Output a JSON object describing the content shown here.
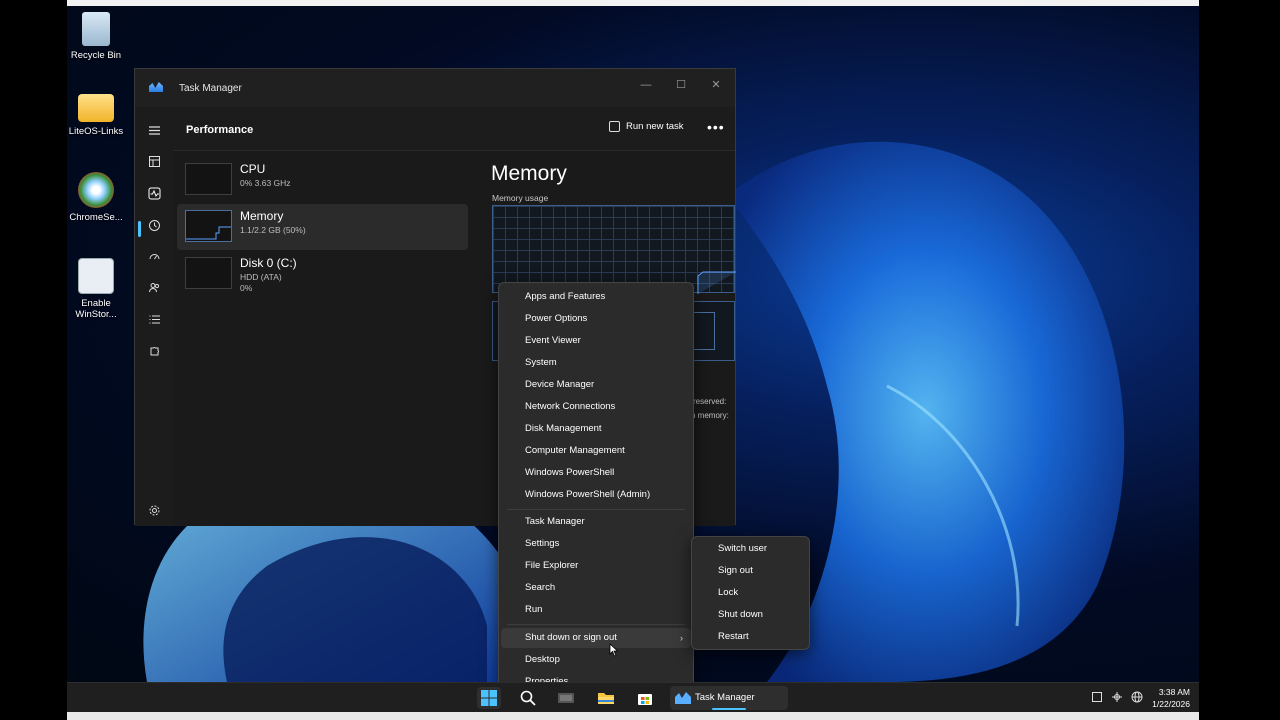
{
  "desktop": {
    "icons": [
      {
        "label": "Recycle Bin"
      },
      {
        "label": "LiteOS-Links"
      },
      {
        "label": "ChromeSe..."
      },
      {
        "label": "Enable WinStor..."
      }
    ]
  },
  "task_manager": {
    "title": "Task Manager",
    "page_title": "Performance",
    "run_new_task": "Run new task",
    "more": "•••",
    "perf_items": [
      {
        "name": "CPU",
        "sub": "0%  3.63 GHz"
      },
      {
        "name": "Memory",
        "sub": "1.1/2.2 GB (50%)"
      },
      {
        "name": "Disk 0 (C:)",
        "sub": "HDD (ATA)\n0%"
      }
    ],
    "detail_title": "Memory",
    "detail_usage_label": "Memory usage",
    "partial": {
      "reserved": "reserved:",
      "memory": "n memory:"
    }
  },
  "context_menu": {
    "items": [
      "Apps and Features",
      "Power Options",
      "Event Viewer",
      "System",
      "Device Manager",
      "Network Connections",
      "Disk Management",
      "Computer Management",
      "Windows PowerShell",
      "Windows PowerShell (Admin)",
      "Task Manager",
      "Settings",
      "File Explorer",
      "Search",
      "Run",
      "Shut down or sign out",
      "Desktop",
      "Properties"
    ],
    "hovered": "Shut down or sign out"
  },
  "submenu": {
    "items": [
      "Switch user",
      "Sign out",
      "Lock",
      "Shut down",
      "Restart"
    ]
  },
  "taskbar": {
    "active_app": "Task Manager",
    "time": "3:38 AM",
    "date": "1/22/2026"
  },
  "colors": {
    "accent": "#4cc2ff",
    "menu_bg": "#2b2b2b",
    "window_bg": "#1c1c1c"
  }
}
